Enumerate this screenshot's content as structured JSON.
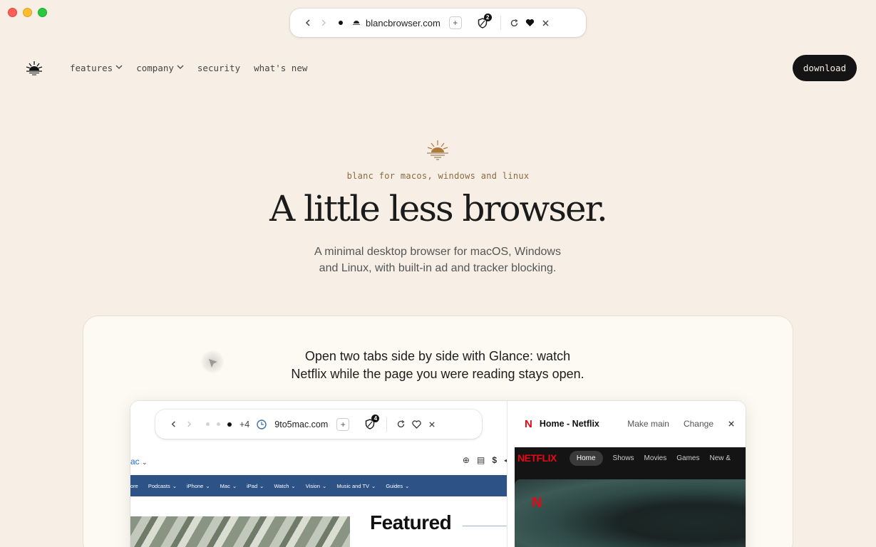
{
  "browser": {
    "url": "blancbrowser.com",
    "tracker_count": "2"
  },
  "nav": {
    "items": [
      {
        "label": "features",
        "dropdown": true
      },
      {
        "label": "company",
        "dropdown": true
      },
      {
        "label": "security",
        "dropdown": false
      },
      {
        "label": "what's new",
        "dropdown": false
      }
    ],
    "download_label": "download"
  },
  "hero": {
    "eyebrow": "blanc for macos, windows and linux",
    "title": "A little less browser.",
    "description_line1": "A minimal desktop browser for macOS, Windows",
    "description_line2": "and Linux, with built-in ad and tracker blocking."
  },
  "showcase": {
    "caption_line1": "Open two tabs side by side with Glance: watch",
    "caption_line2": "Netflix while the page you were reading stays open.",
    "left_tab": {
      "extra_tabs": "+4",
      "url": "9to5mac.com",
      "tracker_count": "4",
      "site_logo_fragment": "ac",
      "site_nav": [
        "ore",
        "Podcasts",
        "iPhone",
        "Mac",
        "iPad",
        "Watch",
        "Vision",
        "Music and TV",
        "Guides"
      ],
      "featured_heading": "Featured"
    },
    "right_tab": {
      "title": "Home - Netflix",
      "make_main": "Make main",
      "change": "Change",
      "netflix_logo": "NETFLIX",
      "netflix_nav": [
        "Home",
        "Shows",
        "Movies",
        "Games",
        "New &"
      ]
    }
  },
  "colors": {
    "background": "#f7efe5",
    "accent_brown": "#8a6a3d",
    "download_bg": "#141414",
    "netflix_red": "#e50914",
    "site_nav_blue": "#2c5286"
  }
}
